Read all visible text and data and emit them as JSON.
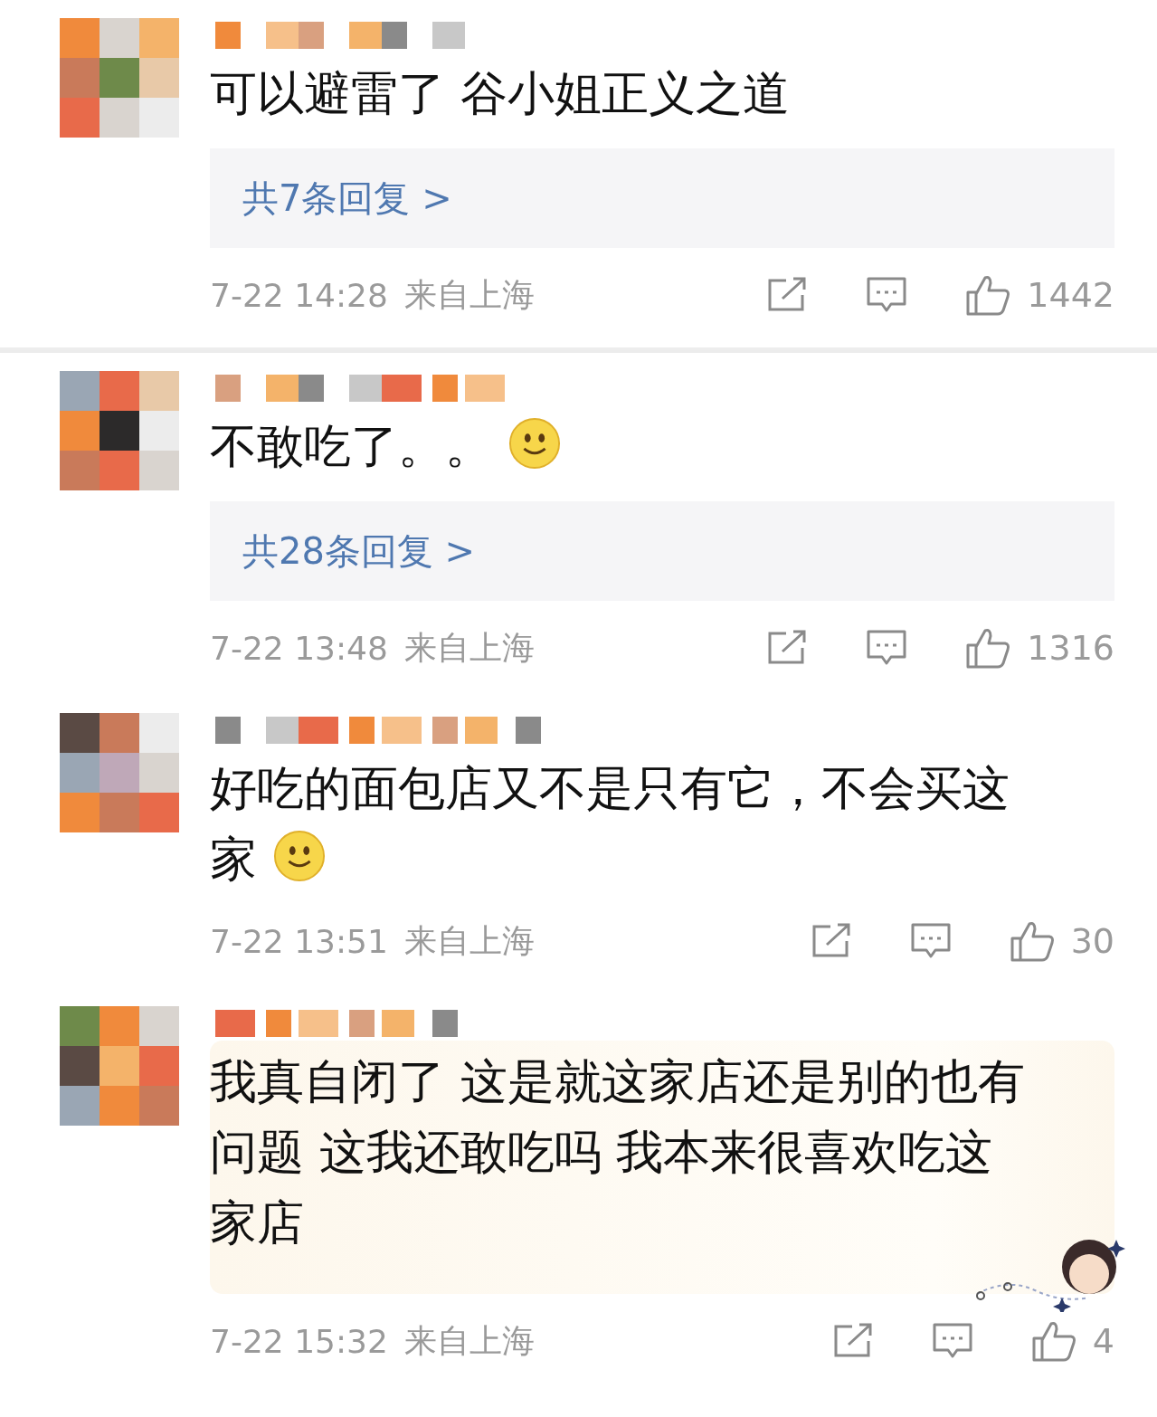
{
  "comments": [
    {
      "lines": [
        "可以避雷了 谷小姐正义之道"
      ],
      "emoji": false,
      "decorated": false,
      "replies": "共7条回复 >",
      "time": "7-22 14:28",
      "location": "来自上海",
      "likes": "1442",
      "divider_below": true
    },
    {
      "lines": [
        "不敢吃了。。"
      ],
      "emoji": true,
      "decorated": false,
      "replies": "共28条回复 >",
      "time": "7-22 13:48",
      "location": "来自上海",
      "likes": "1316",
      "divider_below": false
    },
    {
      "lines": [
        "好吃的面包店又不是只有它，不会买这",
        "家"
      ],
      "emoji": true,
      "decorated": false,
      "time": "7-22 13:51",
      "location": "来自上海",
      "likes": "30",
      "divider_below": false
    },
    {
      "lines": [
        "我真自闭了 这是就这家店还是别的也有",
        "问题 这我还敢吃吗 我本来很喜欢吃这",
        "家店"
      ],
      "emoji": false,
      "decorated": true,
      "time": "7-22 15:32",
      "location": "来自上海",
      "likes": "4",
      "divider_below": false
    }
  ]
}
